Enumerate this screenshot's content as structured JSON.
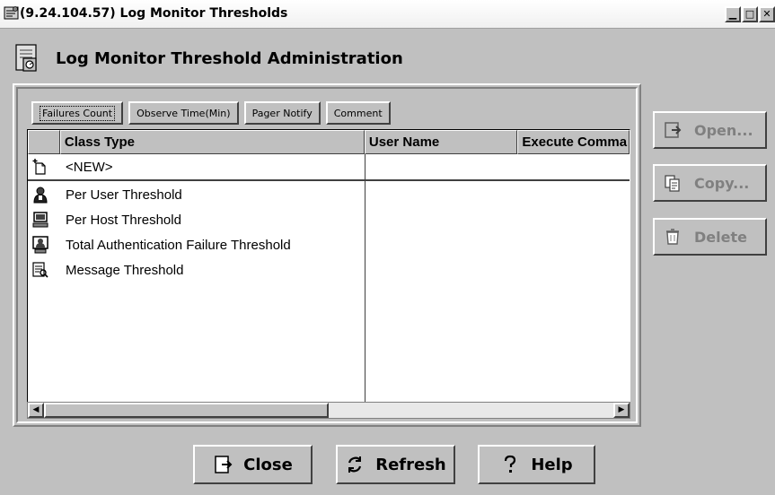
{
  "window": {
    "title": "(9.24.104.57) Log Monitor Thresholds",
    "controls": [
      "minimize",
      "maximize",
      "close"
    ]
  },
  "header": {
    "title": "Log Monitor Threshold Administration"
  },
  "column_buttons": [
    {
      "label": "Failures Count",
      "focused": true
    },
    {
      "label": "Observe Time(Min)"
    },
    {
      "label": "Pager Notify"
    },
    {
      "label": "Comment"
    }
  ],
  "table": {
    "columns": [
      "Class Type",
      "User Name",
      "Execute Comma"
    ],
    "new_row": {
      "icon": "new-item-icon",
      "label": "<NEW>"
    },
    "rows": [
      {
        "icon": "user-icon",
        "class_type": "Per User Threshold",
        "user_name": "",
        "execute_command": ""
      },
      {
        "icon": "host-icon",
        "class_type": "Per Host Threshold",
        "user_name": "",
        "execute_command": ""
      },
      {
        "icon": "auth-failure-icon",
        "class_type": "Total Authentication Failure Threshold",
        "user_name": "",
        "execute_command": ""
      },
      {
        "icon": "message-icon",
        "class_type": "Message Threshold",
        "user_name": "",
        "execute_command": ""
      }
    ]
  },
  "side_buttons": {
    "open": "Open...",
    "copy": "Copy...",
    "delete": "Delete"
  },
  "bottom_buttons": {
    "close": "Close",
    "refresh": "Refresh",
    "help": "Help"
  },
  "colors": {
    "background": "#c0c0c0",
    "disabled_text": "#808080",
    "table_bg": "#ffffff"
  }
}
